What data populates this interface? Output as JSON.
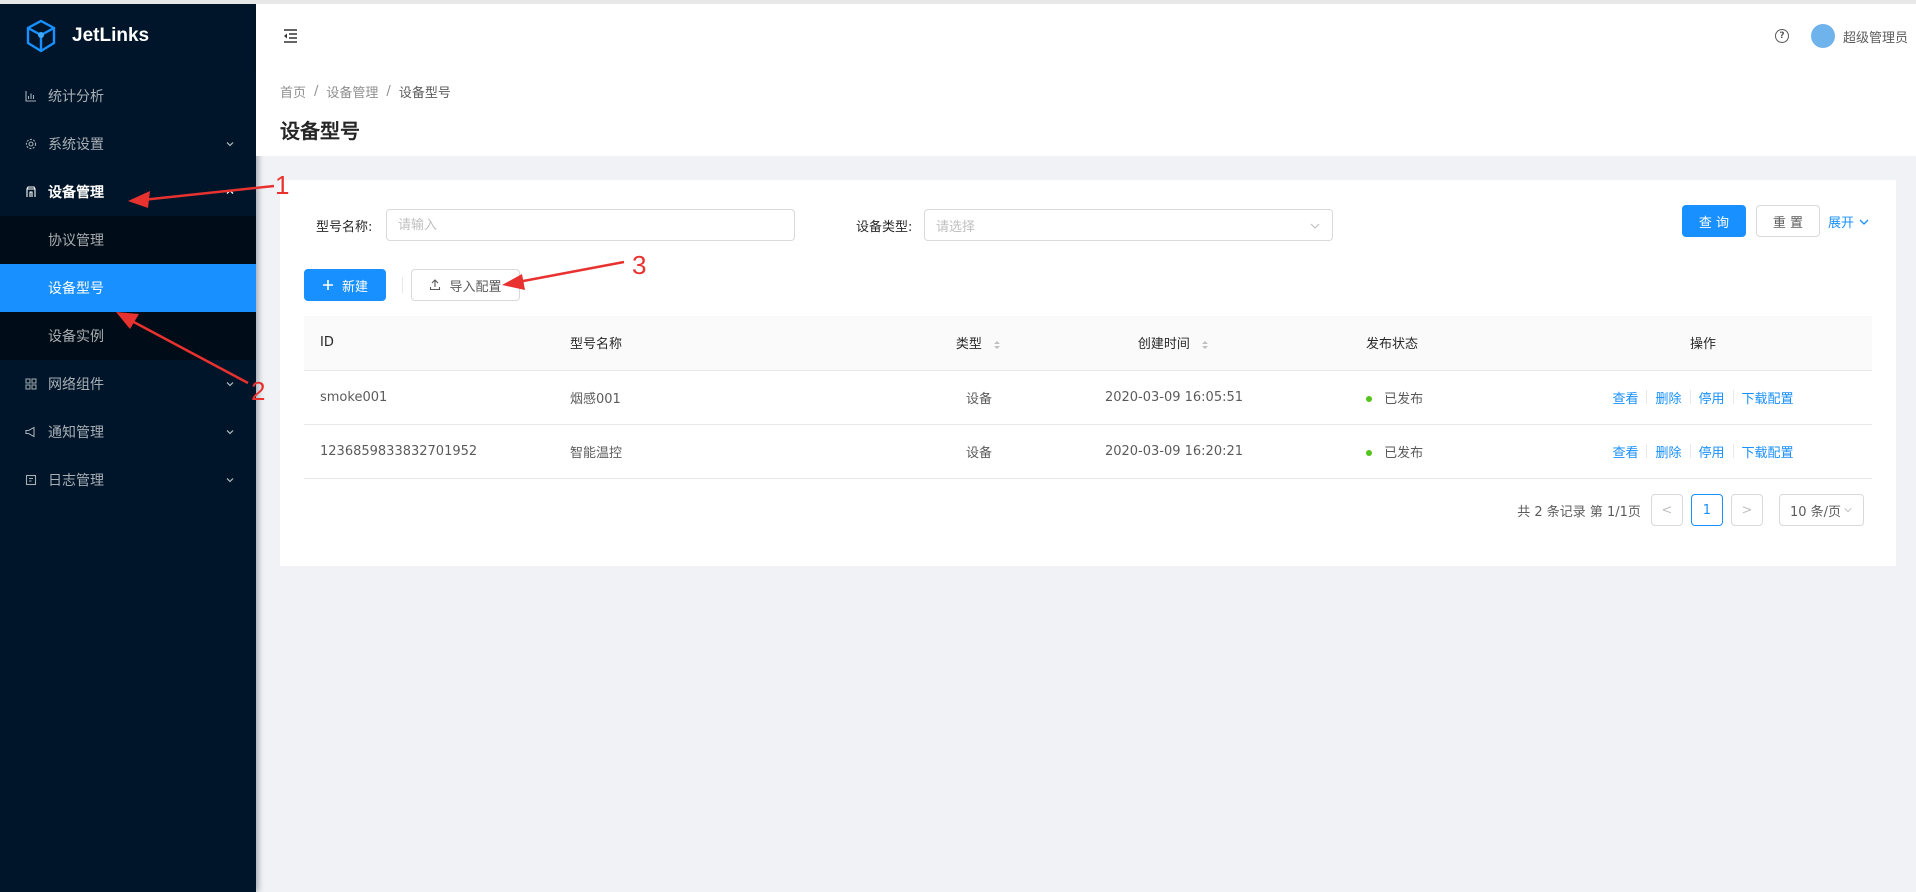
{
  "app": {
    "name": "JetLinks"
  },
  "sidebar": {
    "items": [
      {
        "label": "统计分析",
        "icon": "bar-chart-icon"
      },
      {
        "label": "系统设置",
        "icon": "gear-icon"
      },
      {
        "label": "设备管理",
        "icon": "device-icon"
      },
      {
        "label": "网络组件",
        "icon": "grid-icon"
      },
      {
        "label": "通知管理",
        "icon": "megaphone-icon"
      },
      {
        "label": "日志管理",
        "icon": "log-icon"
      }
    ],
    "submenu": [
      {
        "label": "协议管理"
      },
      {
        "label": "设备型号"
      },
      {
        "label": "设备实例"
      }
    ]
  },
  "header": {
    "user": "超级管理员",
    "help_glyph": "?"
  },
  "breadcrumb": {
    "home": "首页",
    "parent": "设备管理",
    "current": "设备型号",
    "sep": "/"
  },
  "page": {
    "title": "设备型号"
  },
  "filters": {
    "name_label": "型号名称:",
    "name_placeholder": "请输入",
    "type_label": "设备类型:",
    "type_placeholder": "请选择",
    "query": "查 询",
    "reset": "重 置",
    "expand": "展开"
  },
  "toolbar": {
    "new": "新建",
    "import": "导入配置"
  },
  "table": {
    "columns": [
      "ID",
      "型号名称",
      "类型",
      "创建时间",
      "发布状态",
      "操作"
    ],
    "rows": [
      {
        "id": "smoke001",
        "name": "烟感001",
        "type": "设备",
        "created": "2020-03-09 16:05:51",
        "status": "已发布"
      },
      {
        "id": "1236859833832701952",
        "name": "智能温控",
        "type": "设备",
        "created": "2020-03-09 16:20:21",
        "status": "已发布"
      }
    ],
    "actions": [
      "查看",
      "删除",
      "停用",
      "下载配置"
    ]
  },
  "pagination": {
    "summary": "共 2 条记录 第 1/1页",
    "current": "1",
    "size": "10 条/页",
    "prev": "<",
    "next": ">"
  },
  "annotations": {
    "n1": "1",
    "n2": "2",
    "n3": "3"
  },
  "colors": {
    "primary": "#1890ff",
    "sider": "#001529",
    "success": "#52c41a",
    "annotation": "#e8322f"
  }
}
